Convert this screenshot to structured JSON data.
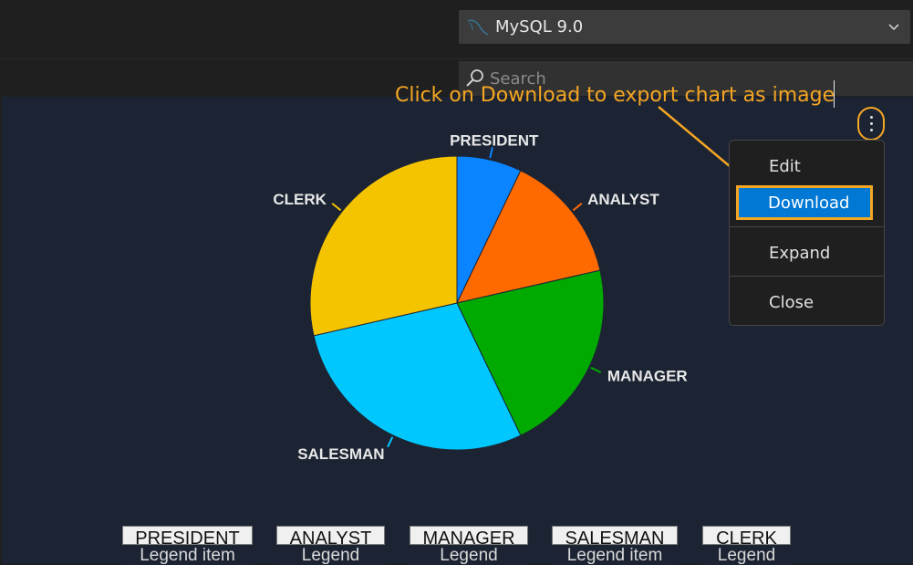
{
  "kernel": {
    "label": "MySQL 9.0"
  },
  "search": {
    "placeholder": "Search"
  },
  "hint": "Click on Download to export chart as image",
  "menu": {
    "items": [
      "Edit",
      "Download",
      "Expand",
      "Close"
    ],
    "selected": "Download"
  },
  "colors": {
    "panel_bg": "#1c2433",
    "accent_orange": "#f5a623",
    "selection_blue": "#0078d4",
    "slices": [
      "#0a84ff",
      "#ff6a00",
      "#00aa00",
      "#00c8ff",
      "#f5c400"
    ]
  },
  "chart_data": {
    "type": "pie",
    "categories": [
      "PRESIDENT",
      "ANALYST",
      "MANAGER",
      "SALESMAN",
      "CLERK"
    ],
    "values": [
      1,
      2,
      3,
      4,
      4
    ],
    "legend": {
      "items": [
        {
          "label": "PRESIDENT",
          "sub": "Legend item"
        },
        {
          "label": "ANALYST",
          "sub": "Legend"
        },
        {
          "label": "MANAGER",
          "sub": "Legend"
        },
        {
          "label": "SALESMAN",
          "sub": "Legend item"
        },
        {
          "label": "CLERK",
          "sub": "Legend"
        }
      ],
      "position": "bottom"
    }
  }
}
